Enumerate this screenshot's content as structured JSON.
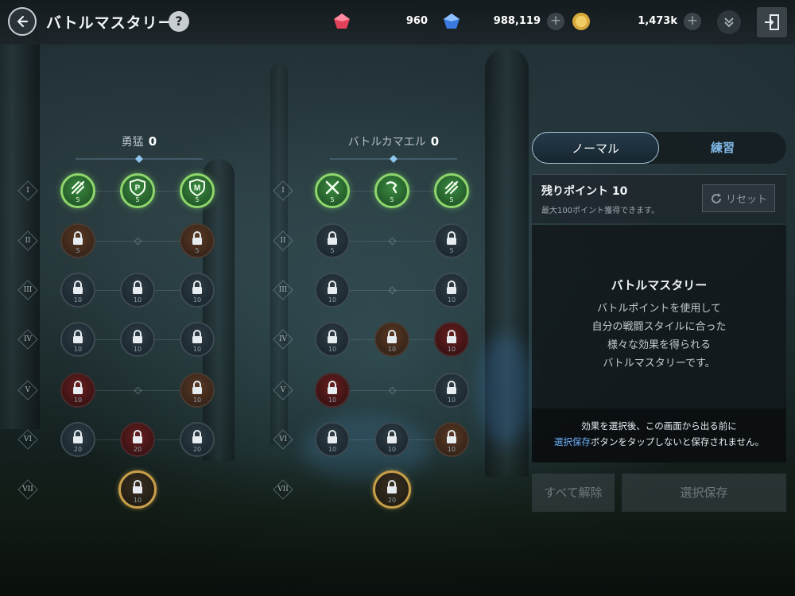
{
  "header": {
    "title": "バトルマスタリー",
    "help_label": "?",
    "currencies": [
      {
        "icon": "red-gem-icon",
        "value": "960"
      },
      {
        "icon": "blue-gem-icon",
        "value": "988,119"
      },
      {
        "icon": "gold-coin-icon",
        "value": "1,473k"
      }
    ]
  },
  "trees": [
    {
      "name": "勇猛",
      "points": "0",
      "rows": [
        {
          "label": "I",
          "nodes": [
            {
              "state": "active",
              "level": "5"
            },
            {
              "state": "active",
              "level": "5",
              "glyph": "P"
            },
            {
              "state": "active",
              "level": "5",
              "glyph": "M"
            }
          ]
        },
        {
          "label": "II",
          "nodes": [
            {
              "state": "locked",
              "level": "5"
            },
            null,
            {
              "state": "locked",
              "level": "5"
            }
          ]
        },
        {
          "label": "III",
          "nodes": [
            {
              "state": "locked",
              "level": "10"
            },
            {
              "state": "locked",
              "level": "10"
            },
            {
              "state": "locked",
              "level": "10"
            }
          ]
        },
        {
          "label": "IV",
          "nodes": [
            {
              "state": "locked",
              "level": "10"
            },
            {
              "state": "locked",
              "level": "10"
            },
            {
              "state": "locked",
              "level": "10"
            }
          ]
        },
        {
          "label": "V",
          "nodes": [
            {
              "state": "locked",
              "level": "10"
            },
            null,
            {
              "state": "locked",
              "level": "10"
            }
          ]
        },
        {
          "label": "VI",
          "nodes": [
            {
              "state": "locked",
              "level": "20"
            },
            {
              "state": "locked",
              "level": "20"
            },
            {
              "state": "locked",
              "level": "20"
            }
          ]
        },
        {
          "label": "VII",
          "nodes": [
            null,
            {
              "state": "locked",
              "level": "10"
            },
            null
          ]
        }
      ]
    },
    {
      "name": "バトルカマエル",
      "points": "0",
      "rows": [
        {
          "label": "I",
          "nodes": [
            {
              "state": "active",
              "level": "5"
            },
            {
              "state": "active",
              "level": "5"
            },
            {
              "state": "active",
              "level": "5"
            }
          ]
        },
        {
          "label": "II",
          "nodes": [
            {
              "state": "locked",
              "level": "5"
            },
            null,
            {
              "state": "locked",
              "level": "5"
            }
          ]
        },
        {
          "label": "III",
          "nodes": [
            {
              "state": "locked",
              "level": "10"
            },
            null,
            {
              "state": "locked",
              "level": "10"
            }
          ]
        },
        {
          "label": "IV",
          "nodes": [
            {
              "state": "locked",
              "level": "10"
            },
            {
              "state": "locked",
              "level": "10"
            },
            {
              "state": "locked",
              "level": "10"
            }
          ]
        },
        {
          "label": "V",
          "nodes": [
            {
              "state": "locked",
              "level": "10"
            },
            null,
            {
              "state": "locked",
              "level": "10"
            }
          ]
        },
        {
          "label": "VI",
          "nodes": [
            {
              "state": "locked",
              "level": "10"
            },
            {
              "state": "locked",
              "level": "10"
            },
            {
              "state": "locked",
              "level": "10"
            }
          ]
        },
        {
          "label": "VII",
          "nodes": [
            null,
            {
              "state": "locked",
              "level": "20"
            },
            null
          ]
        }
      ]
    }
  ],
  "panel": {
    "tabs": [
      {
        "label": "ノーマル",
        "active": true
      },
      {
        "label": "練習",
        "active": false
      }
    ],
    "points_title": "残りポイント 10",
    "points_sub": "最大100ポイント獲得できます。",
    "reset_label": "リセット",
    "desc_title": "バトルマスタリー",
    "desc_lines": [
      "バトルポイントを使用して",
      "自分の戦闘スタイルに合った",
      "様々な効果を得られる",
      "バトルマスタリーです。"
    ],
    "note_line1": "効果を選択後、この画面から出る前に",
    "note_line2_highlight": "選択保存",
    "note_line2_rest": "ボタンをタップしないと保存されません。",
    "clear_all_label": "すべて解除",
    "save_label": "選択保存"
  },
  "colors": {
    "active_ring": "#8fd66c",
    "accent_blue": "#6eb4ff",
    "gold_ring": "#c8a04a"
  }
}
